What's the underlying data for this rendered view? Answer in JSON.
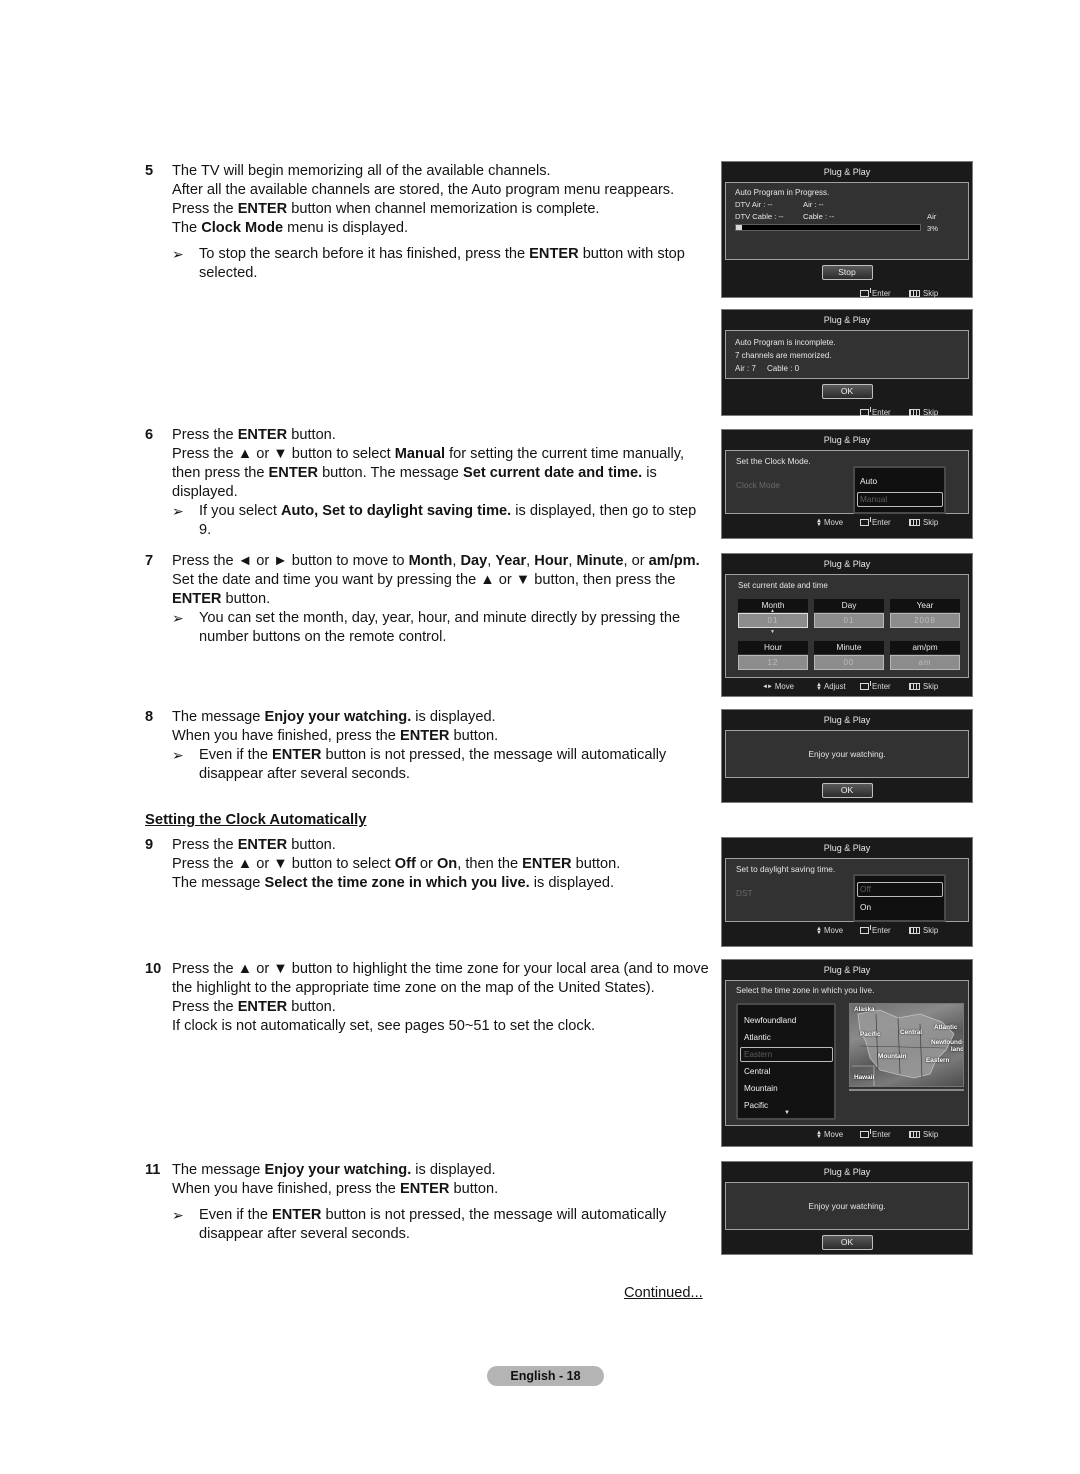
{
  "steps": [
    {
      "num": "5",
      "lines": [
        [
          "The TV will begin memorizing all of the available channels."
        ],
        [
          "After all the available channels are stored, the Auto program menu reappears."
        ],
        [
          "Press the ",
          "ENTER",
          " button when channel memorization is complete."
        ],
        [
          "The ",
          "Clock Mode",
          " menu is displayed."
        ]
      ],
      "note": [
        "To stop the search before it has finished, press the ",
        "ENTER",
        " button with stop selected."
      ]
    },
    {
      "num": "6",
      "lines": [
        [
          "Press the ",
          "ENTER",
          " button."
        ],
        [
          "Press the ▲ or ▼ button to select ",
          "Manual",
          " for setting the current time manually, then press the ",
          "ENTER",
          " button. The message ",
          "Set current date and time.",
          " is displayed."
        ]
      ],
      "note": [
        "If you select ",
        "Auto, Set to daylight saving time.",
        " is displayed, then go to step 9."
      ]
    },
    {
      "num": "7",
      "lines": [
        [
          "Press the ◄ or ► button to move to ",
          "Month",
          ", ",
          "Day",
          ", ",
          "Year",
          ", ",
          "Hour",
          ", ",
          "Minute",
          ", or ",
          "am/pm."
        ],
        [
          "Set the date and time you want by pressing the ▲ or ▼ button, then press the ",
          "ENTER",
          " button."
        ]
      ],
      "note": [
        "You can set the month, day, year, hour, and minute directly by pressing the number buttons on the remote control."
      ]
    },
    {
      "num": "8",
      "lines": [
        [
          "The message ",
          "Enjoy your watching.",
          " is displayed."
        ],
        [
          "When you have finished, press the ",
          "ENTER",
          " button."
        ]
      ],
      "note": [
        "Even if the ",
        "ENTER",
        " button is not pressed, the message will automatically disappear after several seconds."
      ]
    },
    {
      "num": "9",
      "lines": [
        [
          "Press the ",
          "ENTER",
          " button."
        ],
        [
          "Press the ▲ or ▼ button to select ",
          "Off",
          " or ",
          "On",
          ", then the ",
          "ENTER",
          " button."
        ],
        [
          "The message ",
          "Select the time zone in which you live.",
          " is displayed."
        ]
      ],
      "note": null
    },
    {
      "num": "10",
      "lines": [
        [
          "Press the ▲ or ▼ button to highlight the time zone for your local area (and to move the highlight to the appropriate time zone on the map of the United States)."
        ],
        [
          "Press the ",
          "ENTER",
          " button."
        ],
        [
          "If clock is not automatically set, see pages 50~51 to set the clock."
        ]
      ],
      "note": null
    },
    {
      "num": "11",
      "lines": [
        [
          "The message ",
          "Enjoy your watching.",
          " is displayed."
        ],
        [
          "When you have finished, press the ",
          "ENTER",
          " button."
        ]
      ],
      "note": [
        "Even if the ",
        "ENTER",
        " button is not pressed, the message will automatically disappear after several seconds."
      ]
    }
  ],
  "section_heading": "Setting the Clock Automatically",
  "continued": "Continued...",
  "page_label": "English - 18",
  "note_arrow": "➢",
  "osd_common": {
    "title": "Plug & Play",
    "hint_move": "Move",
    "hint_adjust": "Adjust",
    "hint_enter": "Enter",
    "hint_skip": "Skip"
  },
  "osd1": {
    "message": "Auto Program in Progress.",
    "dtv_air": "DTV Air : --",
    "air": "Air : --",
    "dtv_cable": "DTV Cable : --",
    "cable": "Cable : --",
    "source": "Air",
    "progress_percent": 3,
    "progress_label": "3%",
    "button": "Stop"
  },
  "osd2": {
    "line1": "Auto Program is incomplete.",
    "line2": "7 channels are memorized.",
    "line3": "Air : 7     Cable : 0",
    "button": "OK"
  },
  "osd3": {
    "message": "Set the Clock Mode.",
    "field": "Clock Mode",
    "colon": ":",
    "options": [
      "Auto",
      "Manual"
    ],
    "selected": "Manual"
  },
  "osd4": {
    "message": "Set current date and time",
    "fields": [
      {
        "label": "Month",
        "value": "01"
      },
      {
        "label": "Day",
        "value": "01"
      },
      {
        "label": "Year",
        "value": "2008"
      },
      {
        "label": "Hour",
        "value": "12"
      },
      {
        "label": "Minute",
        "value": "00"
      },
      {
        "label": "am/pm",
        "value": "am"
      }
    ],
    "active_field": "Month"
  },
  "osd5": {
    "message": "Enjoy your watching.",
    "button": "OK"
  },
  "osd6": {
    "message": "Set to daylight saving time.",
    "field": "DST",
    "colon": ":",
    "options": [
      "Off",
      "On"
    ],
    "selected": "Off"
  },
  "osd7": {
    "message": "Select the time zone in which you live.",
    "zones": [
      "Newfoundland",
      "Atlantic",
      "Eastern",
      "Central",
      "Mountain",
      "Pacific"
    ],
    "selected": "Eastern",
    "map_labels": [
      "Alaska",
      "Pacific",
      "Central",
      "Atlantic",
      "Newfound-land",
      "Mountain",
      "Eastern",
      "Hawaii"
    ]
  },
  "osd8": {
    "message": "Enjoy your watching.",
    "button": "OK"
  }
}
